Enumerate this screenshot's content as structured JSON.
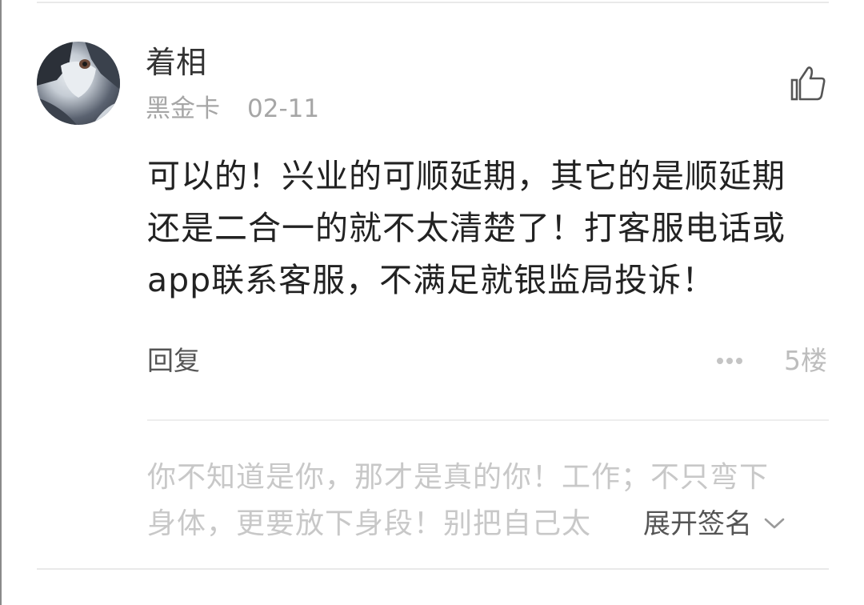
{
  "comment": {
    "user": {
      "name": "着相",
      "badge": "黑金卡",
      "date": "02-11",
      "avatar_icon": "husky-dog-avatar"
    },
    "like_icon": "thumbs-up-icon",
    "text": "可以的！兴业的可顺延期，其它的是顺延期还是二合一的就不太清楚了！打客服电话或app联系客服，不满足就银监局投诉！",
    "reply_label": "回复",
    "more_icon": "more-dots-icon",
    "floor_label": "5楼",
    "signature": {
      "text": "你不知道是你，那才是真的你！工作；不只弯下身体，更要放下身段！别把自己太",
      "expand_label": "展开签名",
      "expand_icon": "chevron-down-icon"
    }
  },
  "colors": {
    "username": "#333333",
    "meta": "#a6a6a6",
    "body_text": "#222222",
    "muted": "#bdbdbd",
    "signature": "#c8c8c8",
    "divider": "#e9e9e9"
  }
}
